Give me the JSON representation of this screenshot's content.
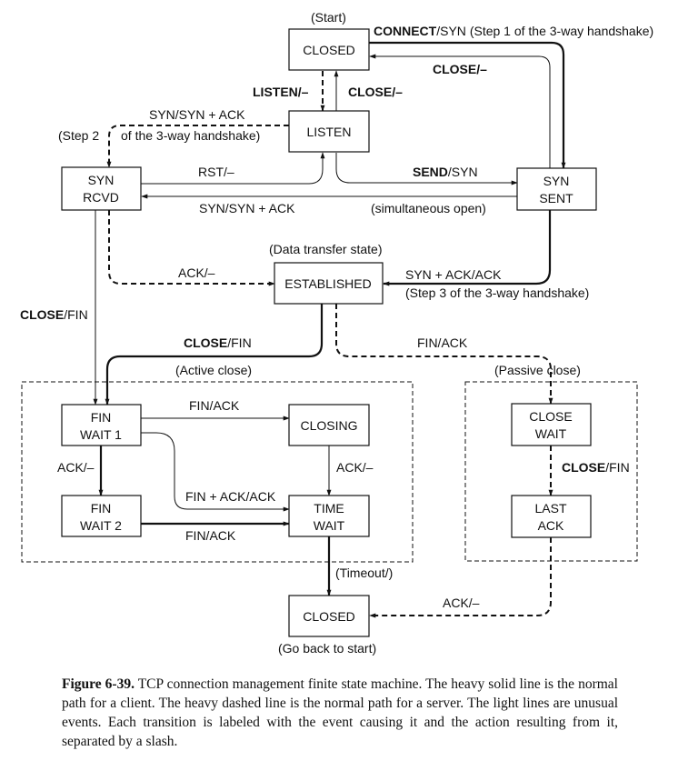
{
  "figure": {
    "title": "TCP connection management finite state machine",
    "states": [
      {
        "id": "closed_top",
        "lines": [
          "CLOSED"
        ]
      },
      {
        "id": "listen",
        "lines": [
          "LISTEN"
        ]
      },
      {
        "id": "syn_rcvd",
        "lines": [
          "SYN",
          "RCVD"
        ]
      },
      {
        "id": "syn_sent",
        "lines": [
          "SYN",
          "SENT"
        ]
      },
      {
        "id": "established",
        "lines": [
          "ESTABLISHED"
        ]
      },
      {
        "id": "fin_wait_1",
        "lines": [
          "FIN",
          "WAIT 1"
        ]
      },
      {
        "id": "closing",
        "lines": [
          "CLOSING"
        ]
      },
      {
        "id": "fin_wait_2",
        "lines": [
          "FIN",
          "WAIT 2"
        ]
      },
      {
        "id": "time_wait",
        "lines": [
          "TIME",
          "WAIT"
        ]
      },
      {
        "id": "close_wait",
        "lines": [
          "CLOSE",
          "WAIT"
        ]
      },
      {
        "id": "last_ack",
        "lines": [
          "LAST",
          "ACK"
        ]
      },
      {
        "id": "closed_bottom",
        "lines": [
          "CLOSED"
        ]
      }
    ],
    "annotations": {
      "start": "(Start)",
      "data_transfer": "(Data transfer state)",
      "active_close": "(Active close)",
      "passive_close": "(Passive close)",
      "go_back": "(Go back to start)",
      "step2_left": "(Step 2",
      "step2_right": "of the 3-way handshake)",
      "simultaneous_open": "(simultaneous open)",
      "step3": "(Step 3 of the 3-way handshake)",
      "step1": "(Step 1 of the 3-way handshake)",
      "timeout": "(Timeout/)"
    },
    "transitions": [
      {
        "id": "connect",
        "from": "closed_top",
        "to": "syn_sent",
        "event": "CONNECT",
        "action": "/SYN",
        "style": "heavy"
      },
      {
        "id": "close_synsent",
        "from": "syn_sent",
        "to": "closed_top",
        "event": "CLOSE",
        "action": "/–",
        "style": "light"
      },
      {
        "id": "listen",
        "from": "closed_top",
        "to": "listen",
        "event": "LISTEN",
        "action": "/–",
        "style": "heavy-dashed"
      },
      {
        "id": "close_listen",
        "from": "listen",
        "to": "closed_top",
        "event": "CLOSE",
        "action": "/–",
        "style": "light"
      },
      {
        "id": "syn_synack",
        "from": "listen",
        "to": "syn_rcvd",
        "event": "",
        "action": "SYN/SYN + ACK",
        "style": "heavy-dashed"
      },
      {
        "id": "rst",
        "from": "syn_rcvd",
        "to": "listen",
        "event": "",
        "action": "RST/–",
        "style": "light"
      },
      {
        "id": "send",
        "from": "listen",
        "to": "syn_sent",
        "event": "SEND",
        "action": "/SYN",
        "style": "light"
      },
      {
        "id": "simopen",
        "from": "syn_sent",
        "to": "syn_rcvd",
        "event": "",
        "action": "SYN/SYN + ACK",
        "style": "light"
      },
      {
        "id": "ack_est",
        "from": "syn_rcvd",
        "to": "established",
        "event": "",
        "action": "ACK/–",
        "style": "heavy-dashed"
      },
      {
        "id": "synack_ack",
        "from": "syn_sent",
        "to": "established",
        "event": "",
        "action": "SYN + ACK/ACK",
        "style": "heavy"
      },
      {
        "id": "close_synrcvd",
        "from": "syn_rcvd",
        "to": "fin_wait_1",
        "event": "CLOSE",
        "action": "/FIN",
        "style": "light"
      },
      {
        "id": "close_est",
        "from": "established",
        "to": "fin_wait_1",
        "event": "CLOSE",
        "action": "/FIN",
        "style": "heavy"
      },
      {
        "id": "fin_ack_est",
        "from": "established",
        "to": "close_wait",
        "event": "",
        "action": "FIN/ACK",
        "style": "heavy-dashed"
      },
      {
        "id": "fin_ack_fw1",
        "from": "fin_wait_1",
        "to": "closing",
        "event": "",
        "action": "FIN/ACK",
        "style": "light"
      },
      {
        "id": "ack_fw1",
        "from": "fin_wait_1",
        "to": "fin_wait_2",
        "event": "",
        "action": "ACK/–",
        "style": "heavy"
      },
      {
        "id": "finack_ack",
        "from": "fin_wait_1",
        "to": "time_wait",
        "event": "",
        "action": "FIN + ACK/ACK",
        "style": "light"
      },
      {
        "id": "ack_closing",
        "from": "closing",
        "to": "time_wait",
        "event": "",
        "action": "ACK/–",
        "style": "light"
      },
      {
        "id": "fin_ack_fw2",
        "from": "fin_wait_2",
        "to": "time_wait",
        "event": "",
        "action": "FIN/ACK",
        "style": "heavy"
      },
      {
        "id": "timeout",
        "from": "time_wait",
        "to": "closed_bottom",
        "event": "",
        "action": "(Timeout/)",
        "style": "heavy"
      },
      {
        "id": "close_cw",
        "from": "close_wait",
        "to": "last_ack",
        "event": "CLOSE",
        "action": "/FIN",
        "style": "heavy-dashed"
      },
      {
        "id": "ack_lastack",
        "from": "last_ack",
        "to": "closed_bottom",
        "event": "",
        "action": "ACK/–",
        "style": "heavy-dashed"
      }
    ]
  },
  "caption": {
    "figure_number": "Figure 6-39.",
    "text": " TCP connection management finite state machine. The heavy solid line is the normal path for a client. The heavy dashed line is the normal path for a server. The light lines are unusual events. Each transition is labeled with the event causing it and the action resulting from it, separated by a slash."
  }
}
